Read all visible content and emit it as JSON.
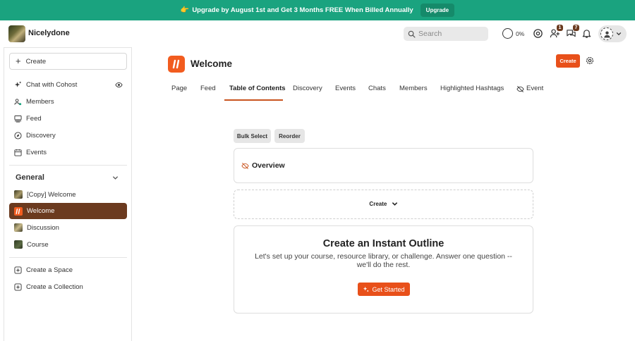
{
  "banner": {
    "emoji": "👉",
    "message": "Upgrade by August 1st and Get 3 Months FREE When Billed Annually",
    "button_label": "Upgrade",
    "background_color": "#1aa37f"
  },
  "header": {
    "brand_name": "Nicelydone",
    "search_placeholder": "Search",
    "progress_label": "0%",
    "invites_badge": "1",
    "chats_badge": "7",
    "icons": [
      "search-icon",
      "progress-ring-icon",
      "gear-icon",
      "add-person-icon",
      "chat-bubbles-icon",
      "bell-icon",
      "avatar",
      "chevron-down-icon"
    ]
  },
  "sidebar": {
    "create_label": "Create",
    "items": [
      {
        "label": "Chat with Cohost",
        "icon": "sparkle-icon"
      },
      {
        "label": "Members",
        "icon": "members-icon"
      },
      {
        "label": "Feed",
        "icon": "feed-icon"
      },
      {
        "label": "Discovery",
        "icon": "compass-icon"
      },
      {
        "label": "Events",
        "icon": "calendar-icon"
      }
    ],
    "section_title": "General",
    "spaces": [
      {
        "label": "[Copy] Welcome"
      },
      {
        "label": "Welcome",
        "active": true
      },
      {
        "label": "Discussion"
      },
      {
        "label": "Course"
      }
    ],
    "actions": [
      {
        "label": "Create a Space"
      },
      {
        "label": "Create a Collection"
      }
    ],
    "active_color": "#6b3a1f"
  },
  "main": {
    "title": "Welcome",
    "create_button": "Create",
    "tabs": [
      {
        "label": "Page"
      },
      {
        "label": "Feed"
      },
      {
        "label": "Table of Contents",
        "active": true
      },
      {
        "label": "Discovery"
      },
      {
        "label": "Events"
      },
      {
        "label": "Chats"
      },
      {
        "label": "Members"
      },
      {
        "label": "Highlighted Hashtags"
      },
      {
        "label": "Event"
      }
    ],
    "bulk_select_label": "Bulk Select",
    "reorder_label": "Reorder",
    "overview_title": "Overview",
    "create_dropdown_label": "Create",
    "outline": {
      "title": "Create an Instant Outline",
      "description": "Let's set up your course, resource library, or challenge. Answer one question -- we'll do the rest.",
      "button_label": "Get Started"
    },
    "accent_color": "#e8501a"
  }
}
